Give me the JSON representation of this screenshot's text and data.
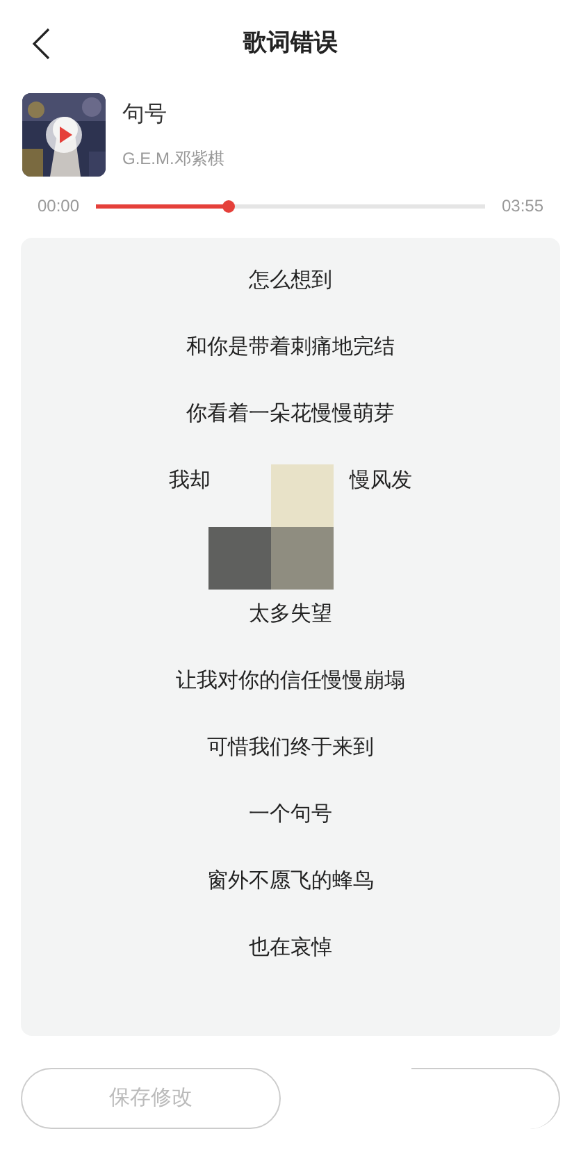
{
  "header": {
    "title": "歌词错误"
  },
  "song": {
    "title": "句号",
    "artist": "G.E.M.邓紫棋",
    "elapsed": "00:00",
    "duration": "03:55",
    "level": 0.34
  },
  "lyrics": [
    {
      "kind": "line",
      "text": "怎么想到"
    },
    {
      "kind": "line",
      "text": "和你是带着刺痛地完结"
    },
    {
      "kind": "line",
      "text": "你看着一朵花慢慢萌芽"
    },
    {
      "kind": "split",
      "left": "我却",
      "right": "慢风发"
    },
    {
      "kind": "masked"
    },
    {
      "kind": "line",
      "text": "太多失望"
    },
    {
      "kind": "line",
      "text": "让我对你的信任慢慢崩塌"
    },
    {
      "kind": "line",
      "text": "可惜我们终于来到"
    },
    {
      "kind": "line",
      "text": "一个句号"
    },
    {
      "kind": "line",
      "text": "窗外不愿飞的蜂鸟"
    },
    {
      "kind": "line",
      "text": "也在哀悼"
    }
  ],
  "buttons": [
    {
      "label": "保存修改",
      "disabled": true
    }
  ]
}
